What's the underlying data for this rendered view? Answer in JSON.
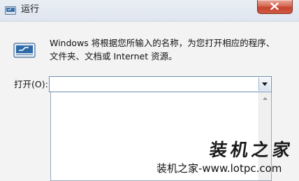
{
  "window": {
    "title": "运行",
    "close_icon": "close-x-icon",
    "close_color": "#c5452f"
  },
  "description": {
    "line1": "Windows 将根据您所输入的名称，为您打开相应的程序、",
    "line2": "文件夹、文档或 Internet 资源。"
  },
  "open_field": {
    "label": "打开(O):",
    "value": "",
    "dropdown_icon": "chevron-down-icon"
  },
  "watermark": {
    "big": "装机之家",
    "small": "装机之家-www.lotpc.com"
  }
}
